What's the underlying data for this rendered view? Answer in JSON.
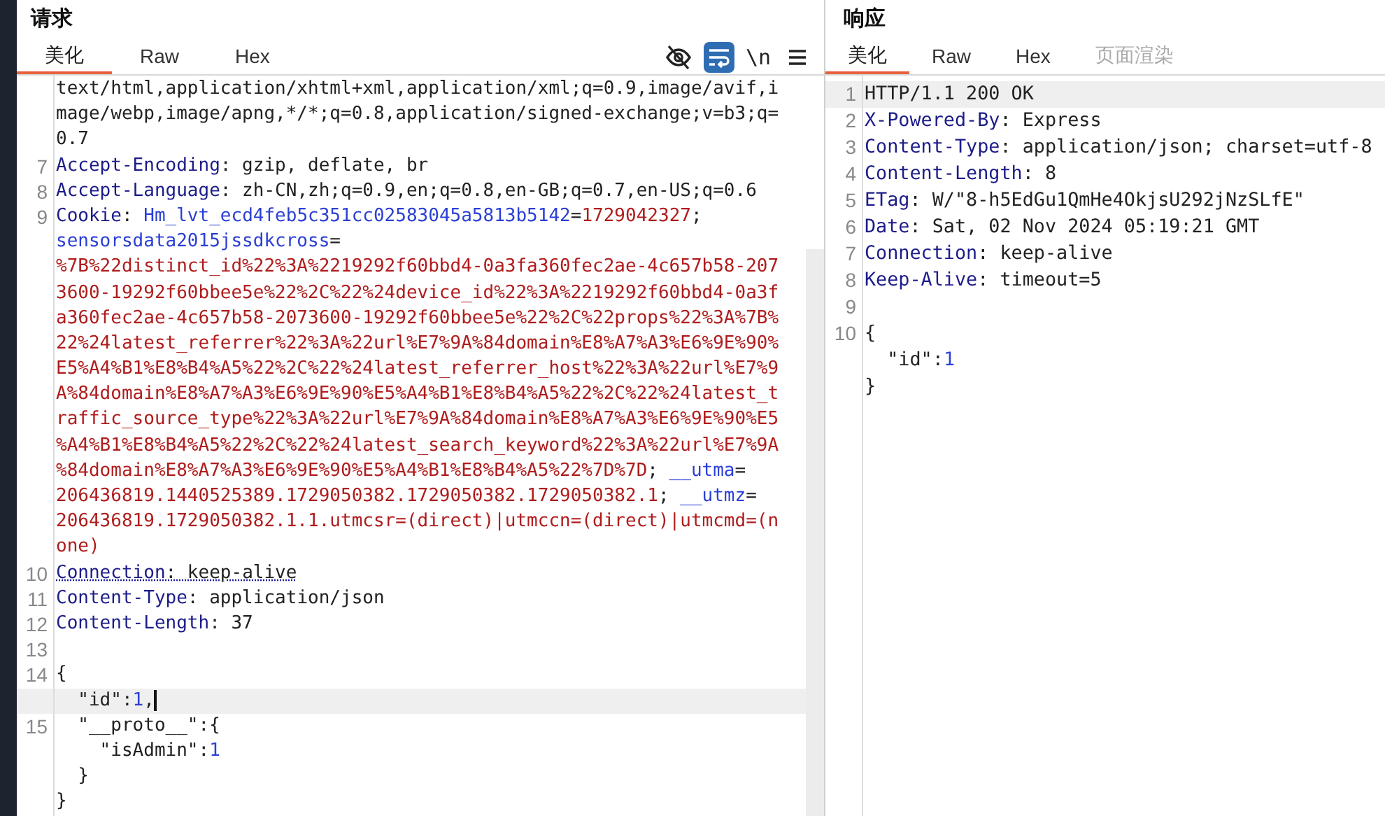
{
  "request": {
    "title": "请求",
    "tabs": [
      {
        "label": "美化",
        "selected": true,
        "disabled": false
      },
      {
        "label": "Raw",
        "selected": false,
        "disabled": false
      },
      {
        "label": "Hex",
        "selected": false,
        "disabled": false
      }
    ],
    "toolbar": [
      {
        "kind": "eye",
        "selected": false
      },
      {
        "kind": "wrap",
        "selected": true
      },
      {
        "kind": "text",
        "label": "\\n",
        "selected": false
      },
      {
        "kind": "menu",
        "selected": false
      }
    ],
    "lines": [
      {
        "segments": [
          {
            "kind": "value",
            "text": "text/html,application/xhtml+xml,application/xml;q=0.9,image/avif,i"
          }
        ]
      },
      {
        "segments": [
          {
            "kind": "value",
            "text": "mage/webp,image/apng,*/*;q=0.8,application/signed-exchange;v=b3;q="
          }
        ]
      },
      {
        "segments": [
          {
            "kind": "value",
            "text": "0.7"
          }
        ]
      },
      {
        "number": "7",
        "segments": [
          {
            "kind": "name",
            "text": "Accept-Encoding"
          },
          {
            "kind": "value",
            "text": ": gzip, deflate, br"
          }
        ]
      },
      {
        "number": "8",
        "segments": [
          {
            "kind": "name",
            "text": "Accept-Language"
          },
          {
            "kind": "value",
            "text": ": zh-CN,zh;q=0.9,en;q=0.8,en-GB;q=0.7,en-US;q=0.6"
          }
        ]
      },
      {
        "number": "9",
        "segments": [
          {
            "kind": "name",
            "text": "Cookie"
          },
          {
            "kind": "value",
            "text": ": "
          },
          {
            "kind": "cookie_name",
            "text": "Hm_lvt_ecd4feb5c351cc02583045a5813b5142"
          },
          {
            "kind": "value",
            "text": "="
          },
          {
            "kind": "cookie_value",
            "text": "1729042327"
          },
          {
            "kind": "value",
            "text": ";"
          }
        ]
      },
      {
        "segments": [
          {
            "kind": "cookie_name",
            "text": "sensorsdata2015jssdkcross"
          },
          {
            "kind": "value",
            "text": "="
          }
        ]
      },
      {
        "segments": [
          {
            "kind": "cookie_value",
            "text": "%7B%22distinct_id%22%3A%2219292f60bbd4-0a3fa360fec2ae-4c657b58-207"
          }
        ]
      },
      {
        "segments": [
          {
            "kind": "cookie_value",
            "text": "3600-19292f60bbee5e%22%2C%22%24device_id%22%3A%2219292f60bbd4-0a3f"
          }
        ]
      },
      {
        "segments": [
          {
            "kind": "cookie_value",
            "text": "a360fec2ae-4c657b58-2073600-19292f60bbee5e%22%2C%22props%22%3A%7B%"
          }
        ]
      },
      {
        "segments": [
          {
            "kind": "cookie_value",
            "text": "22%24latest_referrer%22%3A%22url%E7%9A%84domain%E8%A7%A3%E6%9E%90%"
          }
        ]
      },
      {
        "segments": [
          {
            "kind": "cookie_value",
            "text": "E5%A4%B1%E8%B4%A5%22%2C%22%24latest_referrer_host%22%3A%22url%E7%9"
          }
        ]
      },
      {
        "segments": [
          {
            "kind": "cookie_value",
            "text": "A%84domain%E8%A7%A3%E6%9E%90%E5%A4%B1%E8%B4%A5%22%2C%22%24latest_t"
          }
        ]
      },
      {
        "segments": [
          {
            "kind": "cookie_value",
            "text": "raffic_source_type%22%3A%22url%E7%9A%84domain%E8%A7%A3%E6%9E%90%E5"
          }
        ]
      },
      {
        "segments": [
          {
            "kind": "cookie_value",
            "text": "%A4%B1%E8%B4%A5%22%2C%22%24latest_search_keyword%22%3A%22url%E7%9A"
          }
        ]
      },
      {
        "segments": [
          {
            "kind": "cookie_value",
            "text": "%84domain%E8%A7%A3%E6%9E%90%E5%A4%B1%E8%B4%A5%22%7D%7D"
          },
          {
            "kind": "value",
            "text": "; "
          },
          {
            "kind": "cookie_name",
            "text": "__utma"
          },
          {
            "kind": "value",
            "text": "="
          }
        ]
      },
      {
        "segments": [
          {
            "kind": "cookie_value",
            "text": "206436819.1440525389.1729050382.1729050382.1729050382.1"
          },
          {
            "kind": "value",
            "text": "; "
          },
          {
            "kind": "cookie_name",
            "text": "__utmz"
          },
          {
            "kind": "value",
            "text": "="
          }
        ]
      },
      {
        "segments": [
          {
            "kind": "cookie_value",
            "text": "206436819.1729050382.1.1.utmcsr=(direct)|utmccn=(direct)|utmcmd=(n"
          }
        ]
      },
      {
        "segments": [
          {
            "kind": "cookie_value",
            "text": "one)"
          }
        ]
      },
      {
        "number": "10",
        "dotted_underline": true,
        "segments": [
          {
            "kind": "name",
            "text": "Connection"
          },
          {
            "kind": "value",
            "text": ": keep-alive"
          }
        ]
      },
      {
        "number": "11",
        "segments": [
          {
            "kind": "name",
            "text": "Content-Type"
          },
          {
            "kind": "value",
            "text": ": application/json"
          }
        ]
      },
      {
        "number": "12",
        "segments": [
          {
            "kind": "name",
            "text": "Content-Length"
          },
          {
            "kind": "value",
            "text": ": 37"
          }
        ]
      },
      {
        "number": "13"
      },
      {
        "number": "14",
        "segments": [
          {
            "kind": "value",
            "text": "{"
          }
        ]
      },
      {
        "highlighted": true,
        "caret": true,
        "segments": [
          {
            "kind": "value",
            "text": "  \"id\":"
          },
          {
            "kind": "number",
            "text": "1"
          },
          {
            "kind": "value",
            "text": ","
          }
        ]
      },
      {
        "number": "15",
        "segments": [
          {
            "kind": "value",
            "text": "  \"__proto__\":{"
          }
        ]
      },
      {
        "segments": [
          {
            "kind": "value",
            "text": "    \"isAdmin\":"
          },
          {
            "kind": "number",
            "text": "1"
          }
        ]
      },
      {
        "segments": [
          {
            "kind": "value",
            "text": "  }"
          }
        ]
      },
      {
        "segments": [
          {
            "kind": "value",
            "text": "}"
          }
        ]
      }
    ]
  },
  "response": {
    "title": "响应",
    "tabs": [
      {
        "label": "美化",
        "selected": true,
        "disabled": false
      },
      {
        "label": "Raw",
        "selected": false,
        "disabled": false
      },
      {
        "label": "Hex",
        "selected": false,
        "disabled": false
      },
      {
        "label": "页面渲染",
        "selected": false,
        "disabled": true
      }
    ],
    "lines": [
      {
        "number": "1",
        "highlighted": true,
        "segments": [
          {
            "kind": "value",
            "text": "HTTP/1.1 200 OK"
          }
        ]
      },
      {
        "number": "2",
        "segments": [
          {
            "kind": "name",
            "text": "X-Powered-By"
          },
          {
            "kind": "value",
            "text": ": Express"
          }
        ]
      },
      {
        "number": "3",
        "segments": [
          {
            "kind": "name",
            "text": "Content-Type"
          },
          {
            "kind": "value",
            "text": ": application/json; charset=utf-8"
          }
        ]
      },
      {
        "number": "4",
        "segments": [
          {
            "kind": "name",
            "text": "Content-Length"
          },
          {
            "kind": "value",
            "text": ": 8"
          }
        ]
      },
      {
        "number": "5",
        "segments": [
          {
            "kind": "name",
            "text": "ETag"
          },
          {
            "kind": "value",
            "text": ": W/\"8-h5EdGu1QmHe4OkjsU292jNzSLfE\""
          }
        ]
      },
      {
        "number": "6",
        "segments": [
          {
            "kind": "name",
            "text": "Date"
          },
          {
            "kind": "value",
            "text": ": Sat, 02 Nov 2024 05:19:21 GMT"
          }
        ]
      },
      {
        "number": "7",
        "segments": [
          {
            "kind": "name",
            "text": "Connection"
          },
          {
            "kind": "value",
            "text": ": keep-alive"
          }
        ]
      },
      {
        "number": "8",
        "segments": [
          {
            "kind": "name",
            "text": "Keep-Alive"
          },
          {
            "kind": "value",
            "text": ": timeout=5"
          }
        ]
      },
      {
        "number": "9"
      },
      {
        "number": "10",
        "segments": [
          {
            "kind": "value",
            "text": "{"
          }
        ]
      },
      {
        "segments": [
          {
            "kind": "value",
            "text": "  \"id\":"
          },
          {
            "kind": "number",
            "text": "1"
          }
        ]
      },
      {
        "segments": [
          {
            "kind": "value",
            "text": "}"
          }
        ]
      }
    ]
  }
}
